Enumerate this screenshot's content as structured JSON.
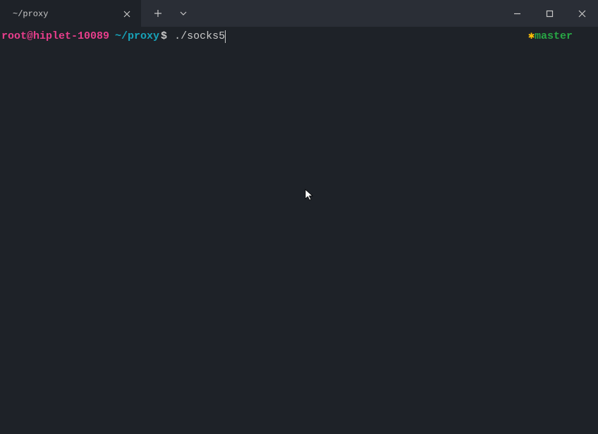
{
  "tab": {
    "title": "~/proxy"
  },
  "prompt": {
    "user_host": "root@hiplet-10089",
    "path": "~/proxy",
    "symbol": "$",
    "command": "./socks5"
  },
  "branch": {
    "indicator": "✱",
    "name": "master"
  }
}
